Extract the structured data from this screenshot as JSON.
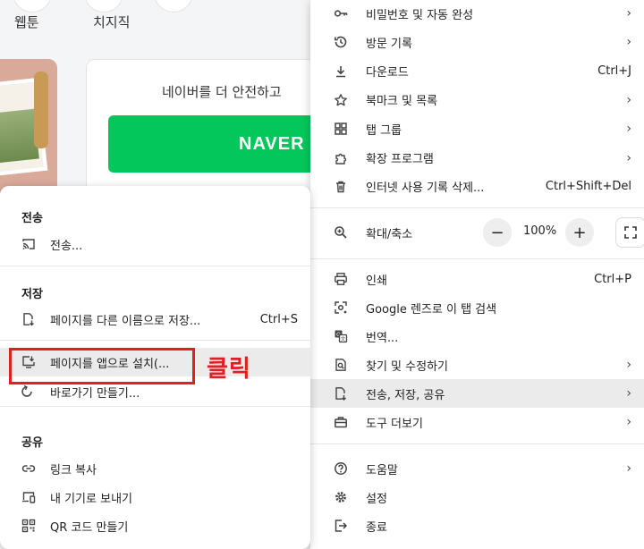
{
  "background": {
    "nav_labels": [
      "웹툰",
      "치지직"
    ],
    "login_text": "네이버를 더 안전하고",
    "login_button": "NAVER",
    "accent_color": "#03c75a"
  },
  "main_menu": {
    "items_top": [
      {
        "label": "비밀번호 및 자동 완성",
        "icon": "key-icon",
        "arrow": true
      },
      {
        "label": "방문 기록",
        "icon": "history-icon",
        "arrow": true
      },
      {
        "label": "다운로드",
        "icon": "download-icon",
        "shortcut": "Ctrl+J"
      },
      {
        "label": "북마크 및 목록",
        "icon": "star-icon",
        "arrow": true
      },
      {
        "label": "탭 그룹",
        "icon": "tab-group-icon",
        "arrow": true
      },
      {
        "label": "확장 프로그램",
        "icon": "puzzle-icon",
        "arrow": true
      },
      {
        "label": "인터넷 사용 기록 삭제...",
        "icon": "trash-icon",
        "shortcut": "Ctrl+Shift+Del"
      }
    ],
    "zoom": {
      "label": "확대/축소",
      "icon": "zoom-icon",
      "minus": "−",
      "value": "100%",
      "plus": "+"
    },
    "items_mid": [
      {
        "label": "인쇄",
        "icon": "print-icon",
        "shortcut": "Ctrl+P"
      },
      {
        "label": "Google 렌즈로 이 탭 검색",
        "icon": "lens-icon"
      },
      {
        "label": "번역...",
        "icon": "translate-icon"
      },
      {
        "label": "찾기 및 수정하기",
        "icon": "find-icon",
        "arrow": true
      },
      {
        "label": "전송, 저장, 공유",
        "icon": "share-save-icon",
        "arrow": true,
        "highlighted": true
      },
      {
        "label": "도구 더보기",
        "icon": "toolbox-icon",
        "arrow": true
      }
    ],
    "items_bottom": [
      {
        "label": "도움말",
        "icon": "help-icon",
        "arrow": true
      },
      {
        "label": "설정",
        "icon": "settings-icon"
      },
      {
        "label": "종료",
        "icon": "exit-icon"
      }
    ]
  },
  "sub_menu": {
    "sections": [
      {
        "heading": "전송",
        "items": [
          {
            "label": "전송...",
            "icon": "cast-icon"
          }
        ]
      },
      {
        "heading": "저장",
        "items": [
          {
            "label": "페이지를 다른 이름으로 저장...",
            "icon": "save-page-icon",
            "shortcut": "Ctrl+S"
          },
          {
            "label": "페이지를 앱으로 설치(...",
            "icon": "install-app-icon",
            "highlighted": true
          },
          {
            "label": "바로가기 만들기...",
            "icon": "shortcut-icon"
          }
        ]
      },
      {
        "heading": "공유",
        "items": [
          {
            "label": "링크 복사",
            "icon": "link-icon"
          },
          {
            "label": "내 기기로 보내기",
            "icon": "send-device-icon"
          },
          {
            "label": "QR 코드 만들기",
            "icon": "qr-icon"
          }
        ]
      }
    ]
  },
  "annotation": {
    "label": "클릭",
    "color": "#e02020"
  }
}
